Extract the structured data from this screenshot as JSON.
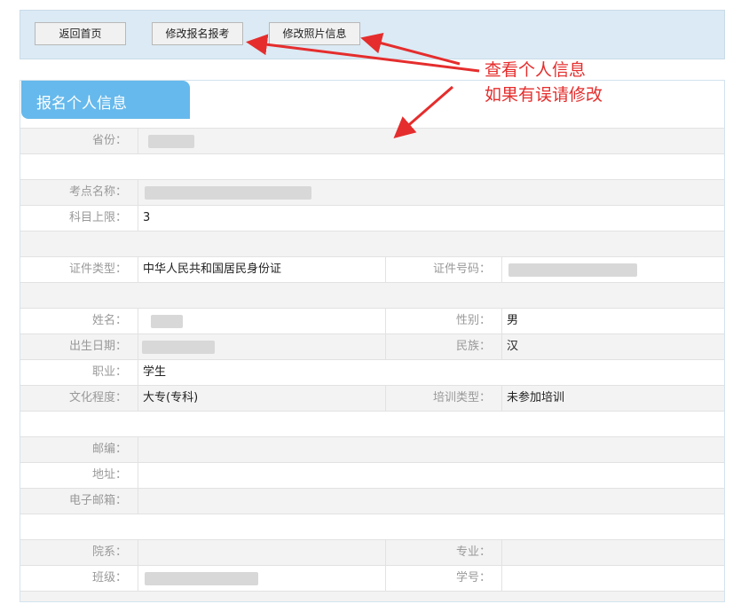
{
  "toolbar": {
    "home_label": "返回首页",
    "edit_registration_label": "修改报名报考",
    "edit_photo_label": "修改照片信息"
  },
  "panel": {
    "title": "报名个人信息"
  },
  "annotation": {
    "line1": "查看个人信息",
    "line2": "如果有误请修改"
  },
  "fields": {
    "province": {
      "label": "省份：",
      "value": ""
    },
    "exam_site": {
      "label": "考点名称：",
      "value": ""
    },
    "subject_limit": {
      "label": "科目上限：",
      "value": "3"
    },
    "id_type": {
      "label": "证件类型：",
      "value": "中华人民共和国居民身份证"
    },
    "id_number": {
      "label": "证件号码：",
      "value": ""
    },
    "name": {
      "label": "姓名：",
      "value": ""
    },
    "gender": {
      "label": "性别：",
      "value": "男"
    },
    "birth_date": {
      "label": "出生日期：",
      "value": ""
    },
    "ethnicity": {
      "label": "民族：",
      "value": "汉"
    },
    "occupation": {
      "label": "职业：",
      "value": "学生"
    },
    "education": {
      "label": "文化程度：",
      "value": "大专(专科)"
    },
    "training_type": {
      "label": "培训类型：",
      "value": "未参加培训"
    },
    "postcode": {
      "label": "邮编：",
      "value": ""
    },
    "address": {
      "label": "地址：",
      "value": ""
    },
    "email": {
      "label": "电子邮箱：",
      "value": ""
    },
    "department": {
      "label": "院系：",
      "value": ""
    },
    "major": {
      "label": "专业：",
      "value": ""
    },
    "class": {
      "label": "班级：",
      "value": ""
    },
    "student_id": {
      "label": "学号：",
      "value": ""
    }
  },
  "colors": {
    "accent": "#66b9ec",
    "annotation": "#e52d2d",
    "toolbar_bg": "#dbeaf4"
  }
}
